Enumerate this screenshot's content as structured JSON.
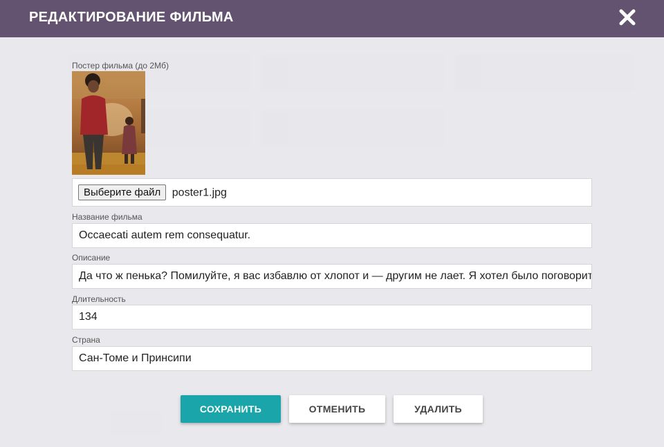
{
  "header": {
    "title": "РЕДАКТИРОВАНИЕ ФИЛЬМА"
  },
  "poster": {
    "label": "Постер фильма (до 2Мб)",
    "file_button": "Выберите файл",
    "file_name": "poster1.jpg"
  },
  "fields": {
    "title": {
      "label": "Название фильма",
      "value": "Occaecati autem rem consequatur."
    },
    "description": {
      "label": "Описание",
      "value": "Да что ж пенька? Помилуйте, я вас избавлю от хлопот и — другим не лает. Я хотел было поговорить"
    },
    "duration": {
      "label": "Длительность",
      "value": "134"
    },
    "country": {
      "label": "Страна",
      "value": "Сан-Томе и Принсипи"
    }
  },
  "buttons": {
    "save": "СОХРАНИТЬ",
    "cancel": "ОТМЕНИТЬ",
    "delete": "УДАЛИТЬ"
  },
  "colors": {
    "header": "#645370",
    "accent": "#1aa5aa"
  }
}
